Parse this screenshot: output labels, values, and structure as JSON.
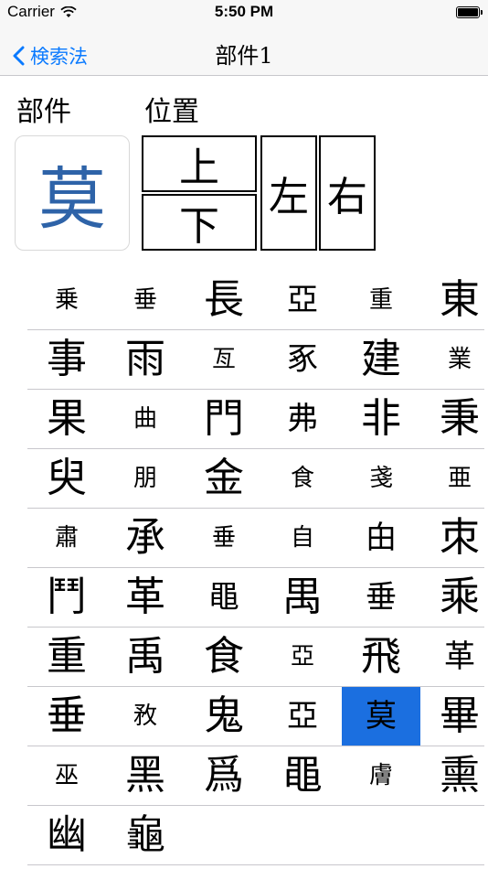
{
  "status": {
    "carrier": "Carrier",
    "time": "5:50 PM"
  },
  "nav": {
    "back_label": "検索法",
    "title": "部件1"
  },
  "labels": {
    "part": "部件",
    "position": "位置"
  },
  "selected_part": "莫",
  "positions": {
    "top": "上",
    "bottom": "下",
    "left": "左",
    "right": "右"
  },
  "grid_rows": [
    [
      {
        "c": "乗",
        "s": "s-small"
      },
      {
        "c": "垂",
        "s": "s-small"
      },
      {
        "c": "長",
        "s": "s-big"
      },
      {
        "c": "亞",
        "s": "s-mid"
      },
      {
        "c": "重",
        "s": "s-small"
      },
      {
        "c": "東",
        "s": "s-big"
      }
    ],
    [
      {
        "c": "事",
        "s": "s-big"
      },
      {
        "c": "雨",
        "s": "s-big"
      },
      {
        "c": "亙",
        "s": "s-small"
      },
      {
        "c": "豖",
        "s": "s-mid"
      },
      {
        "c": "建",
        "s": "s-big"
      },
      {
        "c": "業",
        "s": "s-small"
      }
    ],
    [
      {
        "c": "果",
        "s": "s-big"
      },
      {
        "c": "曲",
        "s": "s-small"
      },
      {
        "c": "門",
        "s": "s-big"
      },
      {
        "c": "弗",
        "s": "s-mid"
      },
      {
        "c": "非",
        "s": "s-big"
      },
      {
        "c": "秉",
        "s": "s-big"
      }
    ],
    [
      {
        "c": "臾",
        "s": "s-big"
      },
      {
        "c": "朋",
        "s": "s-small"
      },
      {
        "c": "金",
        "s": "s-big"
      },
      {
        "c": "食",
        "s": "s-small"
      },
      {
        "c": "戔",
        "s": "s-small"
      },
      {
        "c": "亜",
        "s": "s-small"
      }
    ],
    [
      {
        "c": "肅",
        "s": "s-small"
      },
      {
        "c": "承",
        "s": "s-big"
      },
      {
        "c": "垂",
        "s": "s-small"
      },
      {
        "c": "自",
        "s": "s-small"
      },
      {
        "c": "甶",
        "s": "s-mid"
      },
      {
        "c": "朿",
        "s": "s-big"
      }
    ],
    [
      {
        "c": "鬥",
        "s": "s-big"
      },
      {
        "c": "革",
        "s": "s-big"
      },
      {
        "c": "黽",
        "s": "s-mid"
      },
      {
        "c": "禺",
        "s": "s-big"
      },
      {
        "c": "垂",
        "s": "s-mid"
      },
      {
        "c": "乘",
        "s": "s-big"
      }
    ],
    [
      {
        "c": "重",
        "s": "s-big"
      },
      {
        "c": "禹",
        "s": "s-big"
      },
      {
        "c": "食",
        "s": "s-big"
      },
      {
        "c": "亞",
        "s": "s-small"
      },
      {
        "c": "飛",
        "s": "s-big"
      },
      {
        "c": "革",
        "s": "s-mid"
      }
    ],
    [
      {
        "c": "垂",
        "s": "s-big"
      },
      {
        "c": "敄",
        "s": "s-small"
      },
      {
        "c": "鬼",
        "s": "s-big"
      },
      {
        "c": "亞",
        "s": "s-mid"
      },
      {
        "c": "莫",
        "s": "s-mid",
        "sel": true
      },
      {
        "c": "畢",
        "s": "s-big"
      }
    ],
    [
      {
        "c": "巫",
        "s": "s-small"
      },
      {
        "c": "黑",
        "s": "s-big"
      },
      {
        "c": "爲",
        "s": "s-big"
      },
      {
        "c": "黽",
        "s": "s-big"
      },
      {
        "c": "膚",
        "s": "s-small"
      },
      {
        "c": "熏",
        "s": "s-big"
      }
    ],
    [
      {
        "c": "幽",
        "s": "s-big"
      },
      {
        "c": "龜",
        "s": "s-big"
      }
    ]
  ]
}
